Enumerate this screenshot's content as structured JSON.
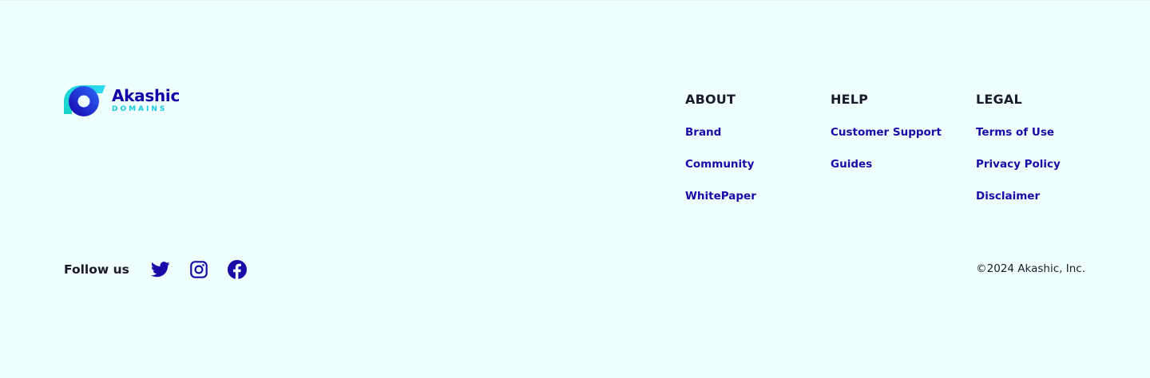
{
  "brand": {
    "name": "Akashic",
    "subtitle": "DOMAINS",
    "colors": {
      "primary": "#1400a8",
      "accent": "#17c9e3",
      "background": "#eefffd"
    }
  },
  "columns": [
    {
      "title": "ABOUT",
      "links": [
        "Brand",
        "Community",
        "WhitePaper"
      ]
    },
    {
      "title": "HELP",
      "links": [
        "Customer Support",
        "Guides"
      ]
    },
    {
      "title": "LEGAL",
      "links": [
        "Terms of Use",
        "Privacy Policy",
        "Disclaimer"
      ]
    }
  ],
  "social": {
    "label": "Follow us",
    "icons": [
      "twitter-icon",
      "instagram-icon",
      "facebook-icon"
    ]
  },
  "copyright": "©2024 Akashic, Inc."
}
